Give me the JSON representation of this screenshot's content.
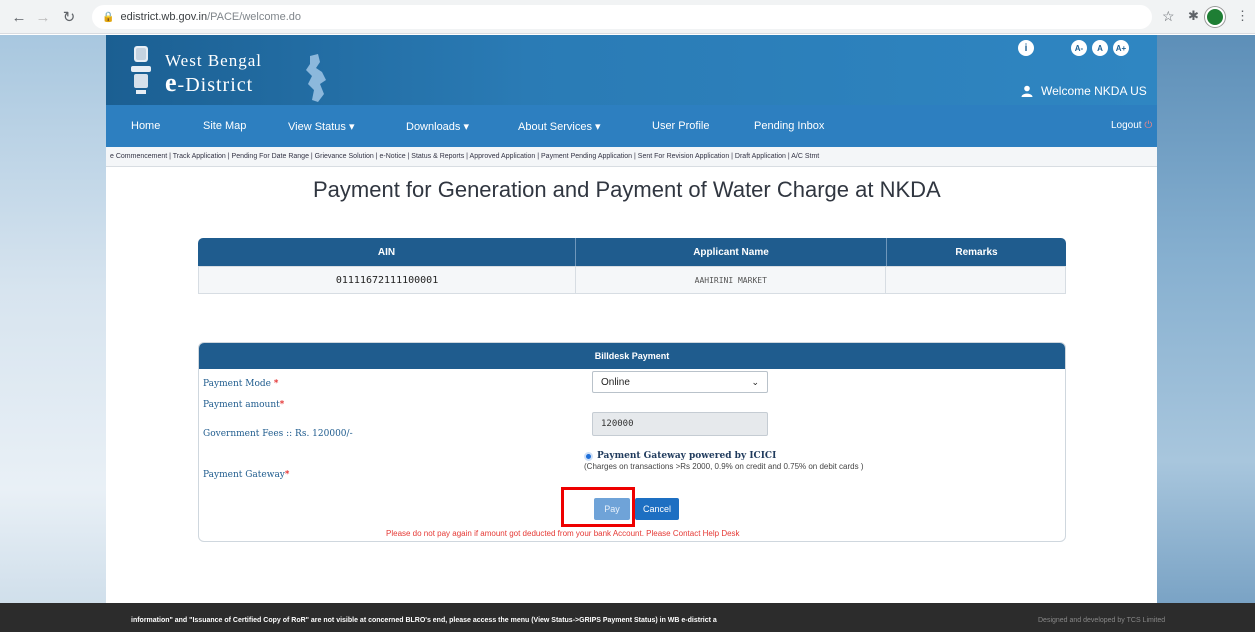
{
  "browser": {
    "url_host": "edistrict.wb.gov.in",
    "url_path": "/PACE/welcome.do"
  },
  "header": {
    "brand_line1": "West Bengal",
    "brand_line2_e": "e",
    "brand_line2_rest": "-District",
    "font_buttons": [
      "A-",
      "A",
      "A+"
    ],
    "welcome_text": "Welcome NKDA US"
  },
  "nav": {
    "items": [
      "Home",
      "Site Map",
      "View Status ▾",
      "Downloads ▾",
      "About Services ▾",
      "User Profile",
      "Pending Inbox"
    ],
    "logout": "Logout"
  },
  "subnav": {
    "text": "e Commencement | Track Application | Pending For Date Range | Grievance Solution | e-Notice | Status & Reports | Approved Application | Payment Pending Application | Sent For Revision Application | Draft Application | A/C Stmt"
  },
  "page": {
    "title": "Payment for Generation and Payment of Water Charge at NKDA"
  },
  "applicant_table": {
    "headers": [
      "AIN",
      "Applicant Name",
      "Remarks"
    ],
    "rows": [
      [
        "01111672111100001",
        "AAHIRINI MARKET",
        ""
      ]
    ]
  },
  "payment": {
    "heading": "Billdesk Payment",
    "mode_label": "Payment Mode",
    "mode_value": "Online",
    "amount_label": "Payment amount",
    "fees_label": "Government Fees :: Rs. 120000/-",
    "amount_value": "120000",
    "gateway_label": "Payment Gateway",
    "gateway_option": "Payment Gateway powered by ICICI",
    "gateway_note": "(Charges on transactions >Rs 2000, 0.9% on credit and 0.75% on debit cards )",
    "pay_button": "Pay",
    "cancel_button": "Cancel",
    "warning": "Please do not pay again if amount got deducted from your bank Account. Please Contact Help Desk"
  },
  "footer": {
    "text": "information\" and \"Issuance of Certified Copy of RoR\" are not visible at concerned BLRO's end, please access the menu (View Status->GRIPS Payment Status) in WB e-district a",
    "credit": "Designed and developed by TCS Limited"
  },
  "colors": {
    "primary": "#1f5c8e",
    "nav": "#2d7fc0",
    "highlight": "#ee0000",
    "warning": "#e53935"
  }
}
